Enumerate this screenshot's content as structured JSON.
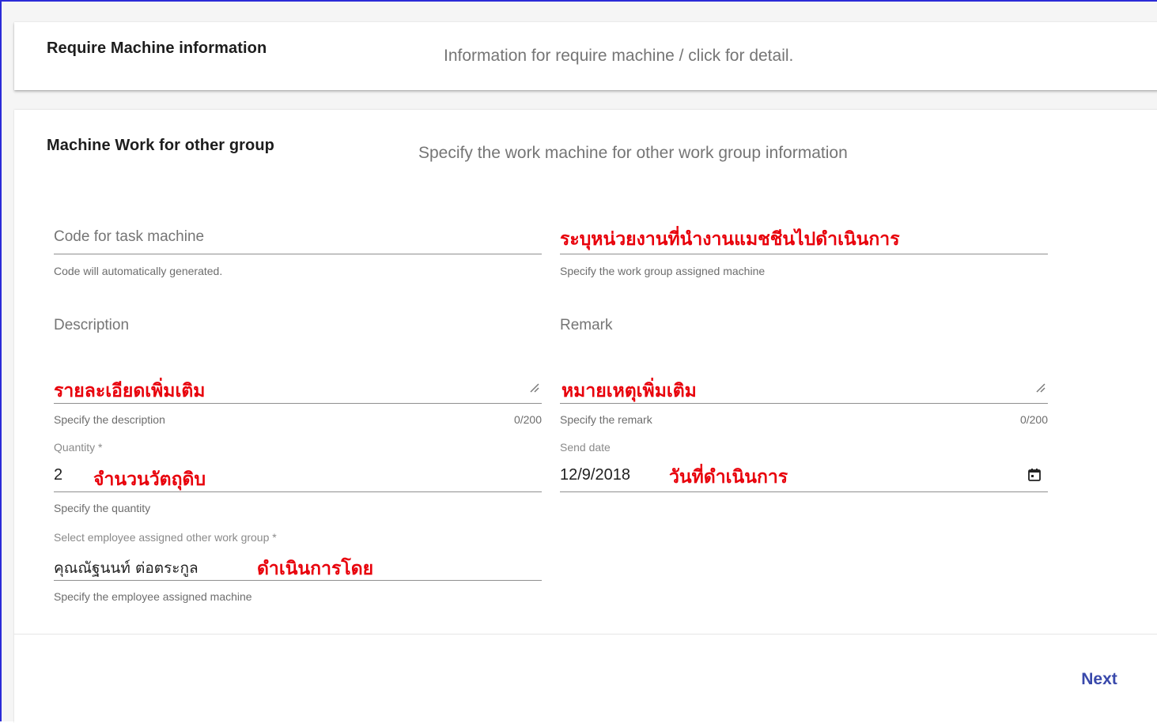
{
  "panels": [
    {
      "title": "Require Machine information",
      "description": "Information for require machine / click for detail."
    },
    {
      "title": "Machine Work for other group",
      "description": "Specify the work machine for other work group information"
    }
  ],
  "form": {
    "code": {
      "placeholder": "Code for task machine",
      "hint": "Code will automatically generated."
    },
    "work_group": {
      "annotation": "ระบุหน่วยงานที่นำงานแมชชีนไปดำเนินการ",
      "hint": "Specify the work group assigned machine"
    },
    "description": {
      "label": "Description",
      "annotation": "รายละเอียดเพิ่มเติม",
      "hint": "Specify the description",
      "counter": "0/200"
    },
    "remark": {
      "label": "Remark",
      "annotation": "หมายเหตุเพิ่มเติม",
      "hint": "Specify the remark",
      "counter": "0/200"
    },
    "quantity": {
      "label": "Quantity *",
      "value": "2",
      "annotation": "จำนวนวัตถุดิบ",
      "hint": "Specify the quantity"
    },
    "send_date": {
      "label": "Send date",
      "value": "12/9/2018",
      "annotation": "วันที่ดำเนินการ",
      "icon": "calendar-icon"
    },
    "employee": {
      "label": "Select employee assigned other work group *",
      "value": "คุณณัฐนนท์ ต่อตระกูล",
      "annotation": "ดำเนินการโดย",
      "hint": "Specify the employee assigned machine"
    }
  },
  "actions": {
    "next_label": "Next"
  },
  "colors": {
    "annotation": "#e8000b",
    "accent": "#3949ab",
    "frame_border": "#2b2bd8"
  }
}
